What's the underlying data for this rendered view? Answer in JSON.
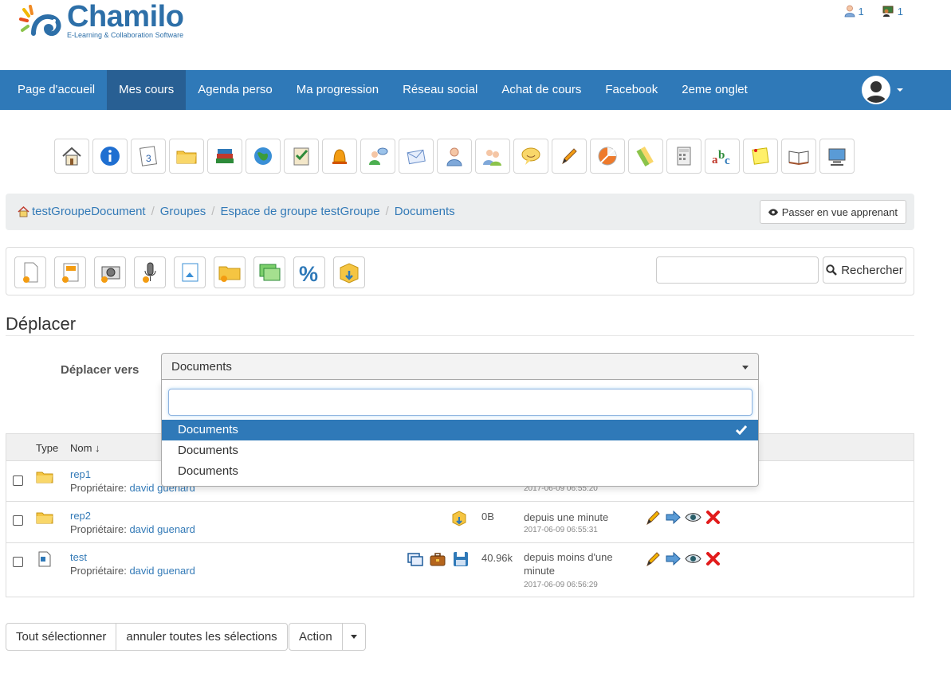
{
  "header": {
    "logo_title": "Chamilo",
    "logo_subtitle": "E-Learning & Collaboration Software",
    "users_online": "1",
    "teachers_online": "1"
  },
  "navbar": {
    "items": [
      {
        "label": "Page d'accueil"
      },
      {
        "label": "Mes cours"
      },
      {
        "label": "Agenda perso"
      },
      {
        "label": "Ma progression"
      },
      {
        "label": "Réseau social"
      },
      {
        "label": "Achat de cours"
      },
      {
        "label": "Facebook"
      },
      {
        "label": "2eme onglet"
      }
    ],
    "active_index": 1
  },
  "tools": [
    "home-icon",
    "info-icon",
    "calendar-icon",
    "folder-icon",
    "books-icon",
    "globe-icon",
    "exercise-icon",
    "bell-icon",
    "users-chat-icon",
    "mail-icon",
    "user-icon",
    "group-icon",
    "chat-icon",
    "pencil-icon",
    "pie-icon",
    "links-icon",
    "calculator-icon",
    "glossary-icon",
    "notes-icon",
    "book-icon",
    "computer-icon"
  ],
  "breadcrumb": {
    "items": [
      {
        "label": "testGroupeDocument"
      },
      {
        "label": "Groupes"
      },
      {
        "label": "Espace de groupe testGroupe"
      },
      {
        "label": "Documents"
      }
    ],
    "learner_view_label": "Passer en vue apprenant"
  },
  "actions": {
    "icons": [
      "new-document-icon",
      "new-template-icon",
      "new-image-icon",
      "record-audio-icon",
      "upload-icon",
      "new-folder-icon",
      "slideshow-icon",
      "quota-icon",
      "download-icon"
    ],
    "search_placeholder": "",
    "search_label": "Rechercher"
  },
  "move_form": {
    "title": "Déplacer",
    "label": "Déplacer vers",
    "selected_value": "Documents",
    "dropdown_search_value": "",
    "options": [
      {
        "label": "Documents",
        "selected": true
      },
      {
        "label": "Documents",
        "selected": false
      },
      {
        "label": "Documents",
        "selected": false
      }
    ]
  },
  "table": {
    "headers": {
      "type": "Type",
      "name": "Nom ↓"
    },
    "owner_label": "Propriétaire:",
    "rows": [
      {
        "name": "rep1",
        "owner": "david guenard",
        "size": "",
        "date": "",
        "date_exact": "2017-06-09 06:55:20",
        "type": "folder"
      },
      {
        "name": "rep2",
        "owner": "david guenard",
        "size": "0B",
        "date": "depuis une minute",
        "date_exact": "2017-06-09 06:55:31",
        "type": "folder"
      },
      {
        "name": "test",
        "owner": "david guenard",
        "size": "40.96k",
        "date": "depuis moins d'une minute",
        "date_exact": "2017-06-09 06:56:29",
        "type": "file"
      }
    ]
  },
  "bottom": {
    "select_all": "Tout sélectionner",
    "unselect_all": "annuler toutes les sélections",
    "action": "Action"
  },
  "colors": {
    "navbar": "#2f79b8",
    "navbar_active": "#285f93",
    "link": "#337ab7",
    "danger": "#e21b1b"
  }
}
